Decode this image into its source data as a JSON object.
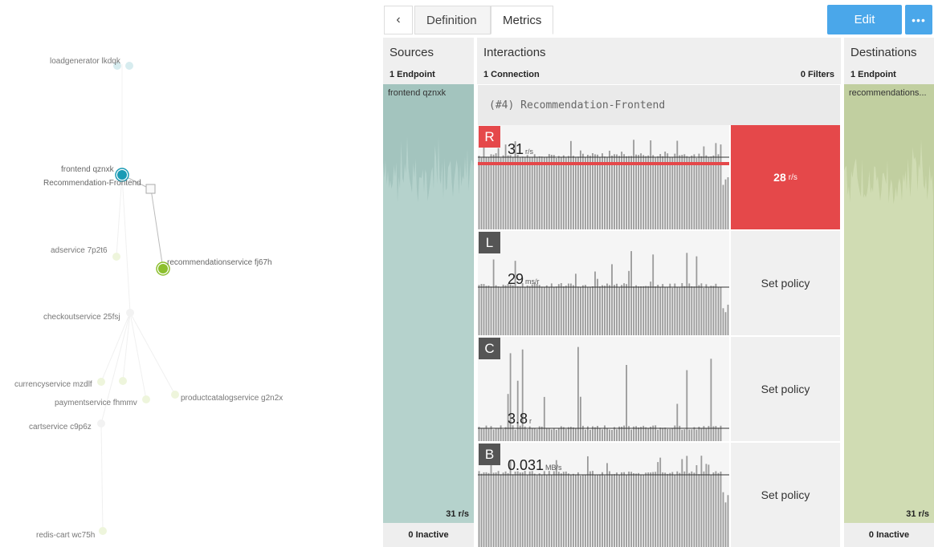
{
  "graph": {
    "nodes": [
      {
        "label": "loadgenerator lkdqk",
        "color": "#cfe8ec"
      },
      {
        "label": "frontend qznxk",
        "color": "#1a9bb5"
      },
      {
        "label": "Recommendation-Frontend",
        "color": "#cccccc"
      },
      {
        "label": "adservice 7p2t6",
        "color": "#eef5dc"
      },
      {
        "label": "recommendationservice fj67h",
        "color": "#8cbf2e"
      },
      {
        "label": "checkoutservice 25fsj",
        "color": "#f0f0f0"
      },
      {
        "label": "currencyservice mzdlf",
        "color": "#eef5dc"
      },
      {
        "label": "paymentservice fhmmv",
        "color": "#eef5dc"
      },
      {
        "label": "productcatalogservice g2n2x",
        "color": "#eef5dc"
      },
      {
        "label": "cartservice c9p6z",
        "color": "#f0f0f0"
      },
      {
        "label": "redis-cart wc75h",
        "color": "#eef5dc"
      }
    ]
  },
  "topbar": {
    "back_icon": "‹",
    "tabs": [
      {
        "label": "Definition",
        "active": false
      },
      {
        "label": "Metrics",
        "active": true
      }
    ],
    "edit_label": "Edit",
    "more_label": "•••",
    "accent": "#4aa7ea"
  },
  "sources": {
    "title": "Sources",
    "count": "1 Endpoint",
    "endpoint": "frontend qznxk",
    "rate": "31 r/s",
    "footer": "0 Inactive",
    "color": "#a3c4be"
  },
  "interactions": {
    "title": "Interactions",
    "count": "1 Connection",
    "filters": "0 Filters",
    "connection": "(#4) Recommendation-Frontend",
    "metrics": [
      {
        "letter": "R",
        "value": "31",
        "unit": "r/s",
        "action": "28",
        "action_unit": "r/s",
        "alert": true
      },
      {
        "letter": "L",
        "value": "29",
        "unit": "ms/r",
        "action": "Set policy",
        "alert": false
      },
      {
        "letter": "C",
        "value": "3.8",
        "unit": "r",
        "action": "Set policy",
        "alert": false
      },
      {
        "letter": "B",
        "value": "0.031",
        "unit": "MB/s",
        "action": "Set policy",
        "alert": false
      }
    ],
    "alert_color": "#e5484a"
  },
  "destinations": {
    "title": "Destinations",
    "count": "1 Endpoint",
    "endpoint": "recommendations...",
    "rate": "31 r/s",
    "footer": "0 Inactive",
    "color": "#c1cfa0"
  }
}
